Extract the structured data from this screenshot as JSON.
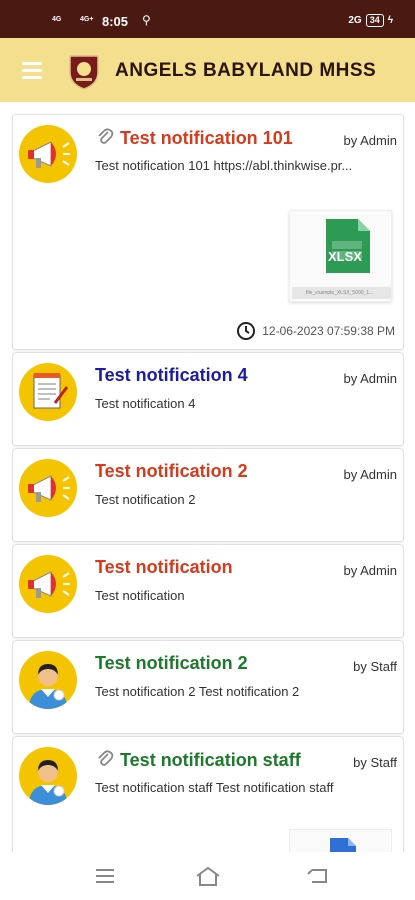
{
  "status_bar": {
    "time": "8:05",
    "signal_1": "4G",
    "signal_2": "4G+",
    "network": "2G",
    "battery": "34"
  },
  "app_bar": {
    "title": "ANGELS BABYLAND MHSS",
    "menu_icon": "hamburger-menu-icon",
    "logo": "school-crest-logo"
  },
  "notifications": [
    {
      "title": "Test notification 101",
      "author": "by Admin",
      "description": "Test notification 101  https://abl.thinkwise.pr...",
      "has_attachment": true,
      "avatar": "megaphone-icon",
      "title_color": "#d73a1c",
      "attachment": {
        "label": "XLSX",
        "file_name": "file_example_XLSX_5000_1..."
      },
      "timestamp": "12-06-2023 07:59:38 PM"
    },
    {
      "title": "Test notification 4",
      "author": "by Admin",
      "description": "Test notification 4",
      "has_attachment": false,
      "avatar": "notepad-icon",
      "title_color": "#1a1ba8"
    },
    {
      "title": "Test notification 2",
      "author": "by Admin",
      "description": "Test notification 2",
      "has_attachment": false,
      "avatar": "megaphone-icon",
      "title_color": "#d73a1c"
    },
    {
      "title": "Test notification",
      "author": "by Admin",
      "description": "Test notification",
      "has_attachment": false,
      "avatar": "megaphone-icon",
      "title_color": "#d73a1c"
    },
    {
      "title": "Test notification 2",
      "author": "by Staff",
      "description": "Test notification 2 Test notification 2",
      "has_attachment": false,
      "avatar": "staff-person-icon",
      "title_color": "#1c7a2a"
    },
    {
      "title": "Test notification staff",
      "author": "by Staff",
      "description": "Test notification staff Test notification staff",
      "has_attachment": true,
      "avatar": "staff-person-icon",
      "title_color": "#1c7a2a"
    }
  ],
  "nav_bar": {
    "icons": [
      "recent-apps-icon",
      "home-icon",
      "back-icon"
    ]
  }
}
